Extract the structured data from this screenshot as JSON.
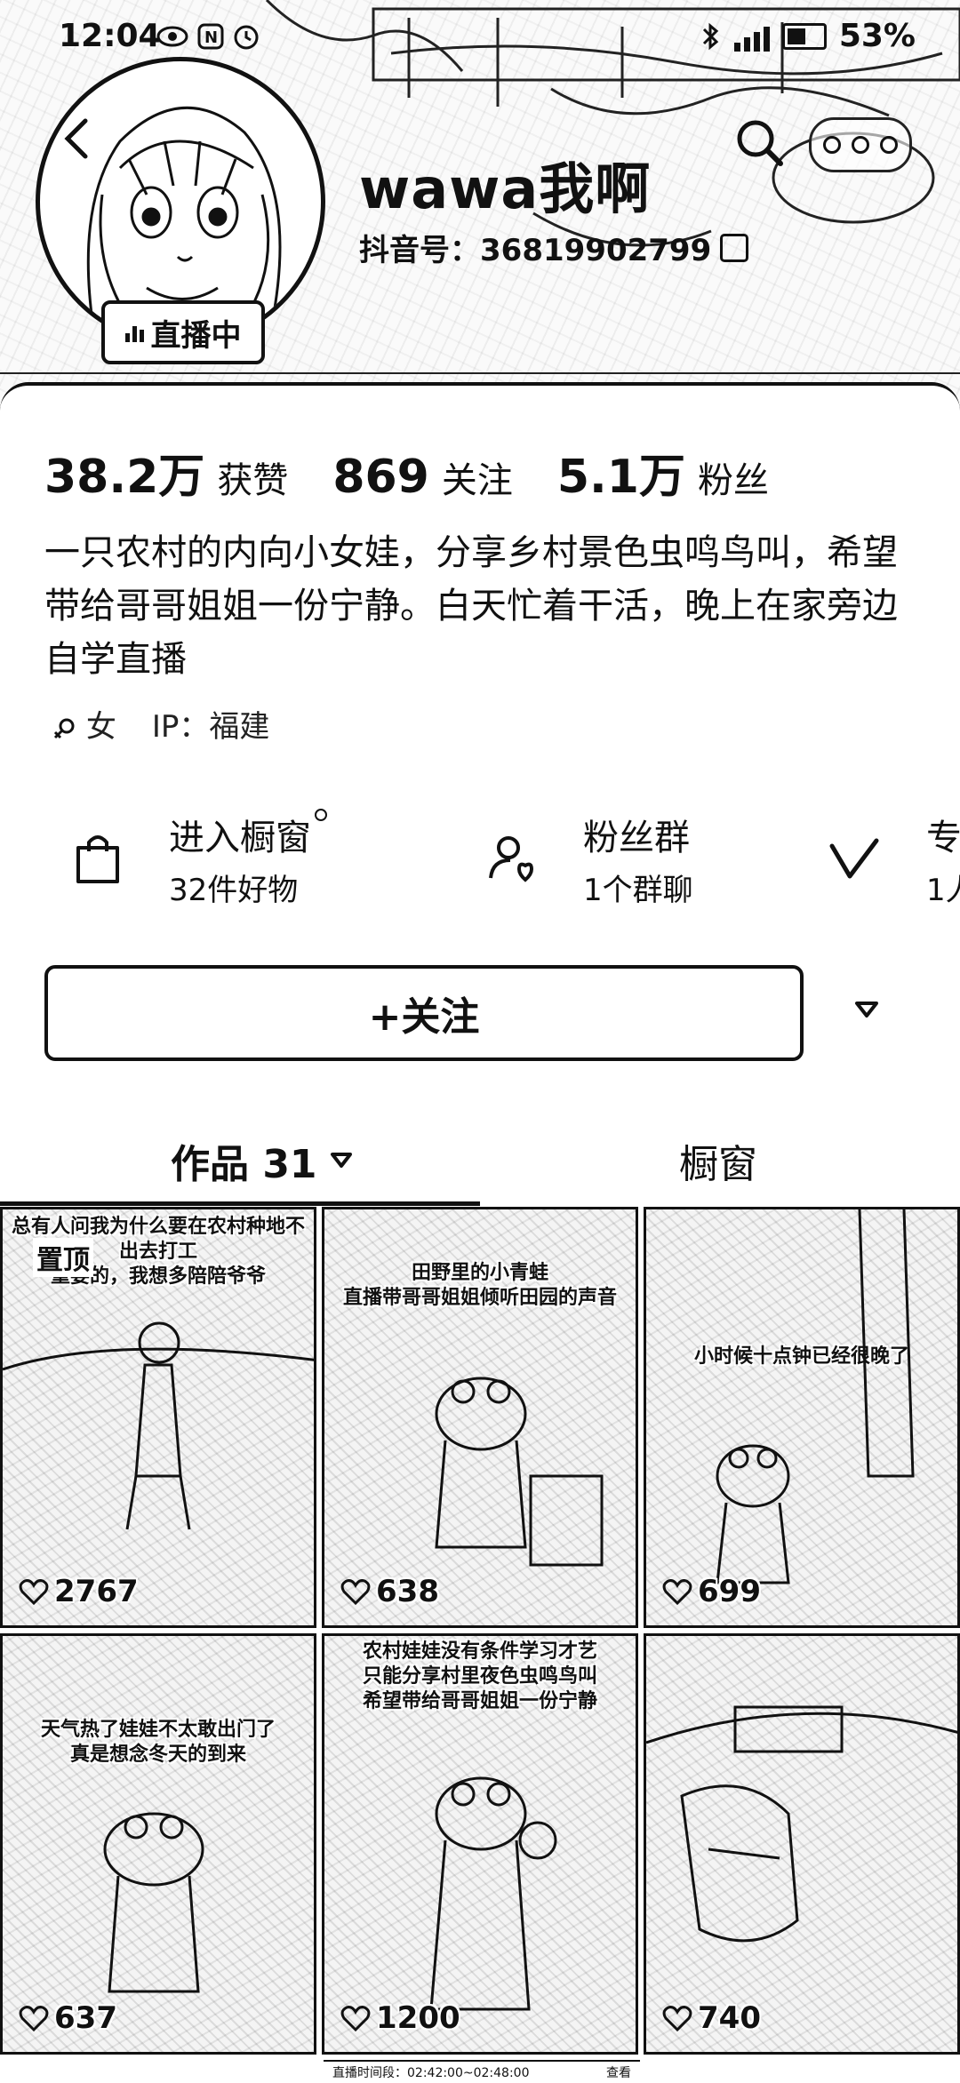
{
  "status_bar": {
    "time": "12:04",
    "battery": "53%"
  },
  "profile": {
    "username": "wawa我啊",
    "douyin_id": "抖音号：36819902799",
    "live_badge": "直播中"
  },
  "stats": [
    {
      "value": "38.2万",
      "label": "获赞"
    },
    {
      "value": "869",
      "label": "关注"
    },
    {
      "value": "5.1万",
      "label": "粉丝"
    }
  ],
  "bio": "一只农村的内向小女娃，分享乡村景色虫鸣鸟叫，希望带给哥哥姐姐一份宁静。白天忙着干活，晚上在家旁边自学直播",
  "meta": {
    "gender": "女",
    "ip": "IP：福建"
  },
  "services": [
    {
      "title": "进入橱窗",
      "subtitle": "32件好物",
      "icon": "shopping-bag-icon"
    },
    {
      "title": "粉丝群",
      "subtitle": "1个群聊",
      "icon": "fan-group-icon"
    },
    {
      "title": "专",
      "subtitle": "1人",
      "icon": "check-v-icon"
    }
  ],
  "follow_button": "+关注",
  "tabs": {
    "works": "作品 31",
    "shop": "橱窗"
  },
  "videos": [
    {
      "caption": "总有人问我为什么要在农村种地不出去打工\n重要的，我想多陪陪爷爷",
      "pinned_label": "置顶",
      "likes": "2767"
    },
    {
      "caption": "田野里的小青蛙\n直播带哥哥姐姐倾听田园的声音",
      "likes": "638"
    },
    {
      "caption": "小时候十点钟已经很晚了",
      "likes": "699"
    },
    {
      "caption": "天气热了娃娃不太敢出门了\n真是想念冬天的到来",
      "likes": "637"
    },
    {
      "caption": "农村娃娃没有条件学习才艺\n只能分享村里夜色虫鸣鸟叫\n希望带给哥哥姐姐一份宁静",
      "likes": "1200"
    },
    {
      "caption": "",
      "likes": "740"
    }
  ],
  "live_bar": {
    "period": "直播时间段：02:42:00~02:48:00",
    "view": "查看"
  },
  "colors": {
    "ink": "#111111",
    "background": "#ffffff"
  }
}
